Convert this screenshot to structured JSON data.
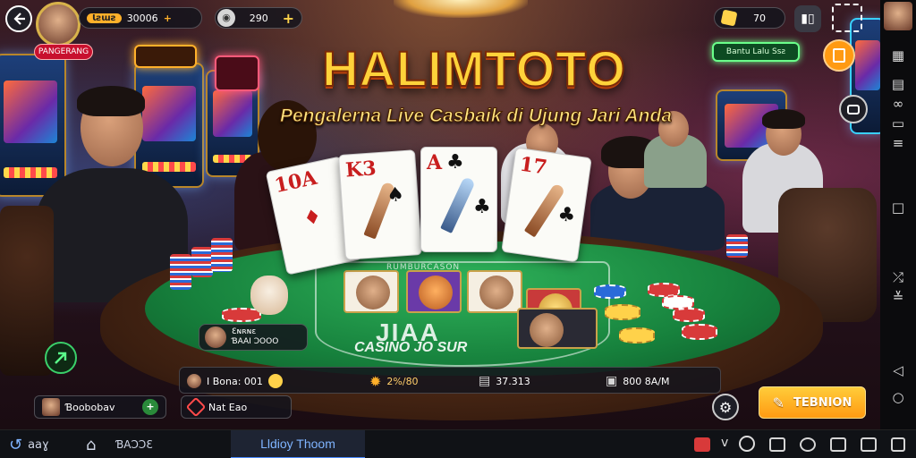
{
  "header": {
    "player_name": "Ɩƨɯƨ",
    "balance": "30006",
    "profile_badge": "PANGERANG",
    "coins": "290",
    "gems": "70"
  },
  "hero": {
    "title": "HALIMTOTO",
    "subtitle": "Pengalerna Live Casbaik di Ujung Jari Anda"
  },
  "room_sign": "Bantu Lalu Ssƨ",
  "table": {
    "felt_small_text": "RUMBURCASON",
    "felt_logo": "JIAA",
    "felt_name": "CASINO JO SUR"
  },
  "cards": [
    {
      "rank": "10A",
      "suit": "♦"
    },
    {
      "rank": "K3",
      "suit": "♠"
    },
    {
      "rank": "A",
      "suit": "♣"
    },
    {
      "rank": "17",
      "suit": "♣"
    }
  ],
  "dealer_tag": {
    "line1": "Ɛɴʀɴɛ",
    "line2": "ƁAAI ƆOOO"
  },
  "chat_user": "Ɓoobobav",
  "bet_button": "Nat Eao",
  "stats": {
    "bonus": "I Bona: 001",
    "win": "2%/80",
    "total": "37.313",
    "jackpot": "800 8A/M"
  },
  "action_button": "TEBNION",
  "nav": {
    "back_label": "aaɣ",
    "home_label": "ƁAƆƆƐ",
    "active_tab": "Lldioy Thoom"
  },
  "colors": {
    "title": "#ffd23a",
    "felt": "#17823d",
    "accent_orange": "#ff9a12",
    "badge_red": "#c8102e"
  }
}
